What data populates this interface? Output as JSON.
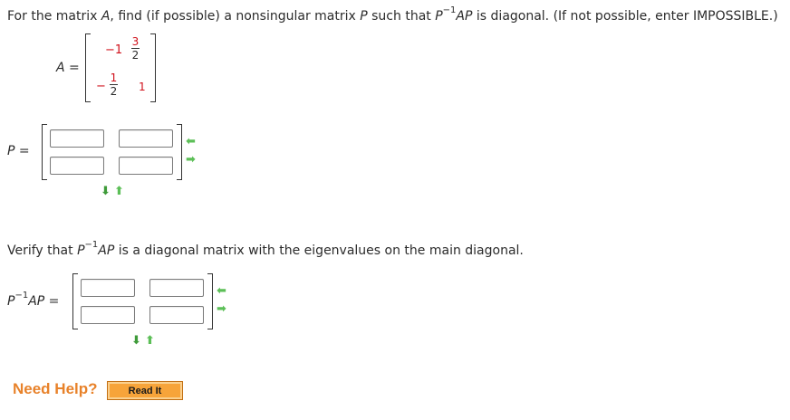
{
  "question": {
    "prefix": "For the matrix ",
    "A": "A",
    "middle": ", find (if possible) a nonsingular matrix ",
    "P": "P",
    "middle2": " such that ",
    "P2": "P",
    "exp": "−1",
    "AP": "AP",
    "suffix": " is diagonal. (If not possible, enter IMPOSSIBLE.)"
  },
  "matrixA": {
    "label": "A =",
    "r1c1": "−1",
    "r1c2_num": "3",
    "r1c2_den": "2",
    "r2c1_sign": "−",
    "r2c1_num": "1",
    "r2c1_den": "2",
    "r2c2": "1"
  },
  "matrixP": {
    "label": "P ="
  },
  "verify": {
    "prefix": "Verify that ",
    "P": "P",
    "exp": "−1",
    "AP": "AP",
    "suffix": " is a diagonal matrix with the eigenvalues on the main diagonal."
  },
  "matrixPAP": {
    "label_P": "P",
    "label_exp": "−1",
    "label_AP": "AP ="
  },
  "arrows": {
    "left": "⬅",
    "right": "➡",
    "down": "⬇",
    "up": "⬆"
  },
  "help": {
    "need_help": "Need Help?",
    "read_it": "Read It"
  }
}
